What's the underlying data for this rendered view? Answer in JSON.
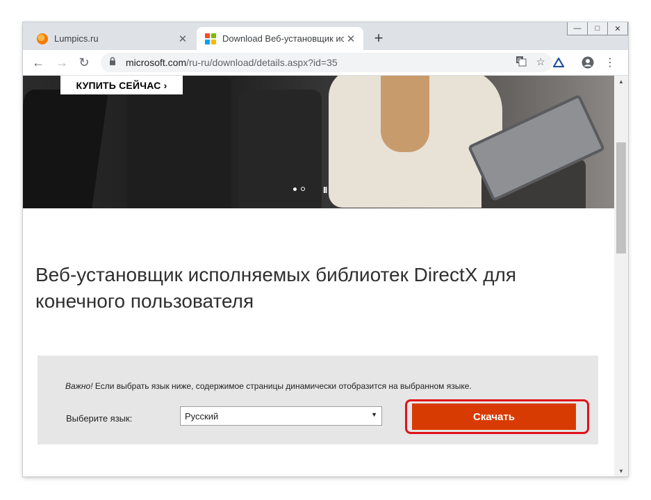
{
  "browser": {
    "tabs": [
      {
        "title": "Lumpics.ru",
        "close": "✕",
        "favicon": "orange-icon"
      },
      {
        "title": "Download Веб-установщик испо",
        "close": "✕",
        "favicon": "microsoft-logo-icon"
      }
    ],
    "new_tab": "+",
    "window_controls": {
      "minimize": "—",
      "maximize": "□",
      "close": "✕"
    },
    "url_host": "microsoft.com",
    "url_path": "/ru-ru/download/details.aspx?id=35",
    "nav": {
      "back": "←",
      "forward": "→",
      "reload": "↻"
    }
  },
  "hero": {
    "buy_now": "КУПИТЬ СЕЙЧАС ›",
    "pause": "II"
  },
  "main": {
    "title": "Веб-установщик исполняемых библиотек DirectX для конечного пользователя"
  },
  "download": {
    "notice_em": "Важно!",
    "notice_text": " Если выбрать язык ниже, содержимое страницы динамически отобразится на выбранном языке.",
    "language_label": "Выберите язык:",
    "language_selected": "Русский",
    "download_button": "Скачать"
  },
  "colors": {
    "download_button": "#d83b01",
    "highlight": "#e0131a"
  }
}
